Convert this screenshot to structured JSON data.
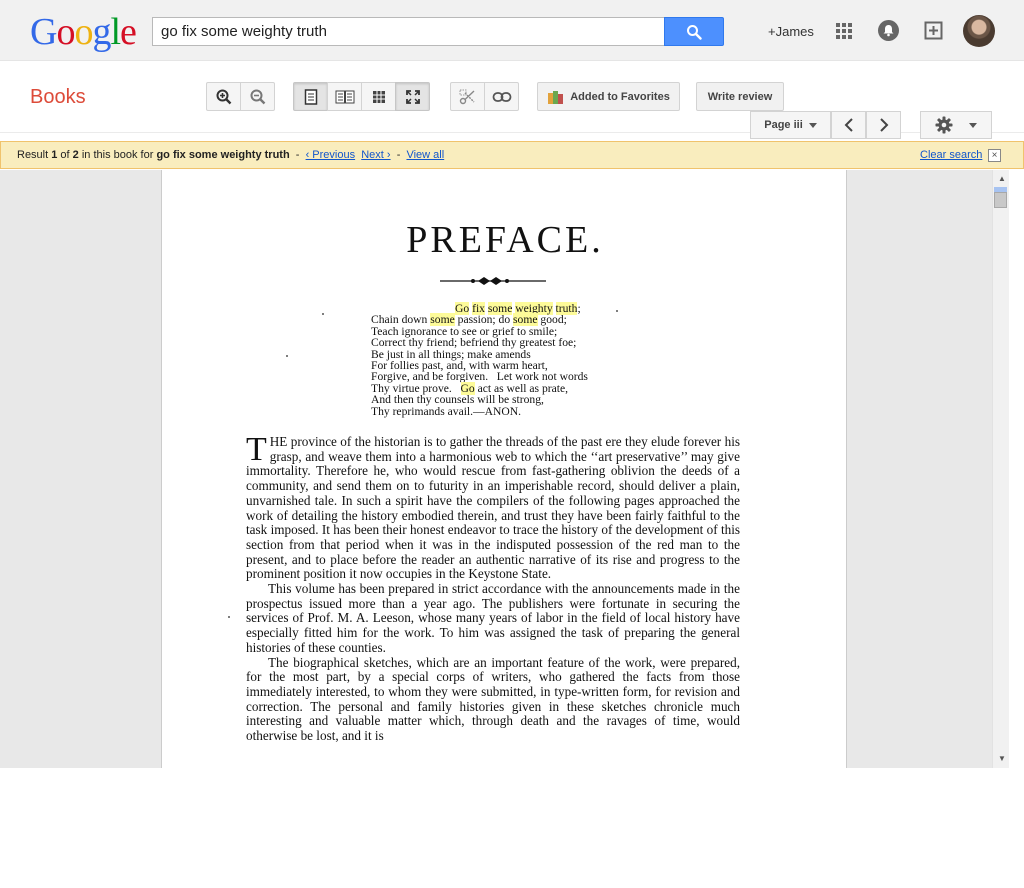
{
  "header": {
    "logo_letters": [
      {
        "ch": "G",
        "color": "#3369e8"
      },
      {
        "ch": "o",
        "color": "#d50f25"
      },
      {
        "ch": "o",
        "color": "#eeb211"
      },
      {
        "ch": "g",
        "color": "#3369e8"
      },
      {
        "ch": "l",
        "color": "#009925"
      },
      {
        "ch": "e",
        "color": "#d50f25"
      }
    ],
    "search_value": "go fix some weighty truth",
    "user_link": "+James"
  },
  "toolbar": {
    "section_title": "Books",
    "favorites_label": "Added to Favorites",
    "review_label": "Write review",
    "page_label": "Page iii"
  },
  "result_bar": {
    "prefix": "Result ",
    "current": "1",
    "of": " of ",
    "total": "2",
    "middle": " in this book for ",
    "query": "go fix some weighty truth",
    "sep1": "  -  ",
    "previous": "‹ Previous",
    "next": "Next ›",
    "sep2": "  -  ",
    "view_all": "View all",
    "clear": "Clear search",
    "close": "×"
  },
  "page": {
    "title": "PREFACE.",
    "poem": {
      "line1_pre": "",
      "line1_hl1": "Go",
      "line1_mid1": " ",
      "line1_hl2": "fix",
      "line1_mid2": " ",
      "line1_hl3": "some",
      "line1_mid3": " ",
      "line1_hl4": "weighty",
      "line1_mid4": " ",
      "line1_hl5": "truth",
      "line1_post": ";",
      "line2_pre": "Chain down ",
      "line2_hl1": "some",
      "line2_mid": " passion; do ",
      "line2_hl2": "some",
      "line2_post": " good;",
      "line3": "Teach ignorance to see or grief to smile;",
      "line4": "Correct thy friend; befriend thy greatest foe;",
      "line5": "Be just in all things; make amends",
      "line6": "For follies past, and, with warm heart,",
      "line7": "Forgive, and be forgiven.   Let work not words",
      "line8_pre": "Thy virtue prove.   ",
      "line8_hl": "Go",
      "line8_post": " act as well as prate,",
      "line9": "And then thy counsels will be strong,",
      "line10": "Thy reprimands avail.—ANON."
    },
    "para1_cap": "T",
    "para1": "HE province of the historian is to gather the threads of the past ere they elude forever his grasp, and weave them into a harmonious web to which the ‘‘art preservative’’ may give immortality.   Therefore he, who would rescue from fast-gathering oblivion the deeds of a community, and send them on to futurity in an imperishable record, should deliver a plain, unvarnished tale. In such a spirit have the compilers of the following pages approached the work of detailing the history embodied therein, and trust they have been fairly faithful to the task imposed.   It has been their honest endeavor to trace the history of the development of this section from that period when it was in the indisputed possession of the red man to the present, and to place before the reader an authentic narrative of its rise and progress to the prominent position it now occupies in the Keystone State.",
    "para2": "This volume has been prepared in strict accordance with the announcements made in the prospectus issued more than a year ago.   The publishers were fortunate in securing the services of Prof. M. A. Leeson, whose many years of labor in the field of local history have especially fitted him for the work.  To him was assigned the task of preparing the general histories of these counties.",
    "para3": "The biographical sketches, which are an important feature of the work, were prepared, for the most part, by a special corps of writers, who gathered the facts from those immediately interested, to whom they were submitted, in type-written form, for revision and correction.   The personal and family histories given in these sketches chronicle much interesting and valuable matter which, through death and the ravages of time, would otherwise be lost, and it is"
  },
  "icons": {
    "search": "search-icon",
    "apps": "apps-grid-icon",
    "notifications": "bell-icon",
    "share": "plus-box-icon",
    "zoom_in": "zoom-in-icon",
    "zoom_out": "zoom-out-icon",
    "single_page": "single-page-icon",
    "two_page": "two-page-icon",
    "thumbnails": "thumbnails-icon",
    "fullscreen": "fullscreen-icon",
    "clip": "scissors-icon",
    "link": "link-icon",
    "favorites": "books-stack-icon",
    "prev": "chevron-left-icon",
    "next": "chevron-right-icon",
    "settings": "gear-icon"
  }
}
